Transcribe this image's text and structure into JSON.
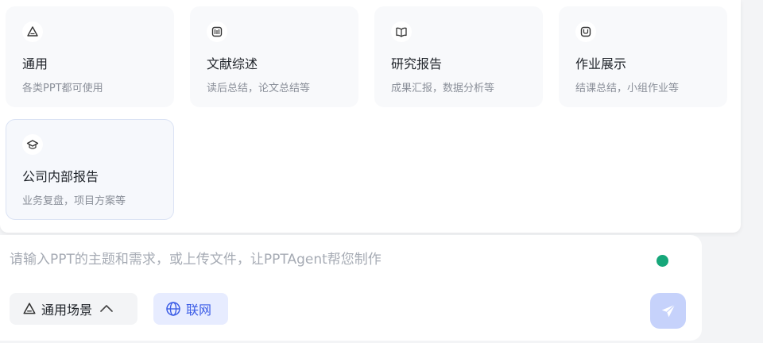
{
  "scenes": [
    {
      "title": "通用",
      "desc": "各类PPT都可使用",
      "icon": "triangle-icon"
    },
    {
      "title": "文献综述",
      "desc": "读后总结，论文总结等",
      "icon": "book-icon"
    },
    {
      "title": "研究报告",
      "desc": "成果汇报，数据分析等",
      "icon": "open-book-icon"
    },
    {
      "title": "作业展示",
      "desc": "结课总结，小组作业等",
      "icon": "assignment-icon"
    },
    {
      "title": "公司内部报告",
      "desc": "业务复盘，项目方案等",
      "icon": "graduation-cap-icon"
    }
  ],
  "composer": {
    "placeholder": "请输入PPT的主题和需求，或上传文件，让PPTAgent帮您制作",
    "value": "",
    "scene_label": "通用场景",
    "web_label": "联网",
    "status_color": "#16a77a",
    "accent_color": "#3c5de6"
  }
}
